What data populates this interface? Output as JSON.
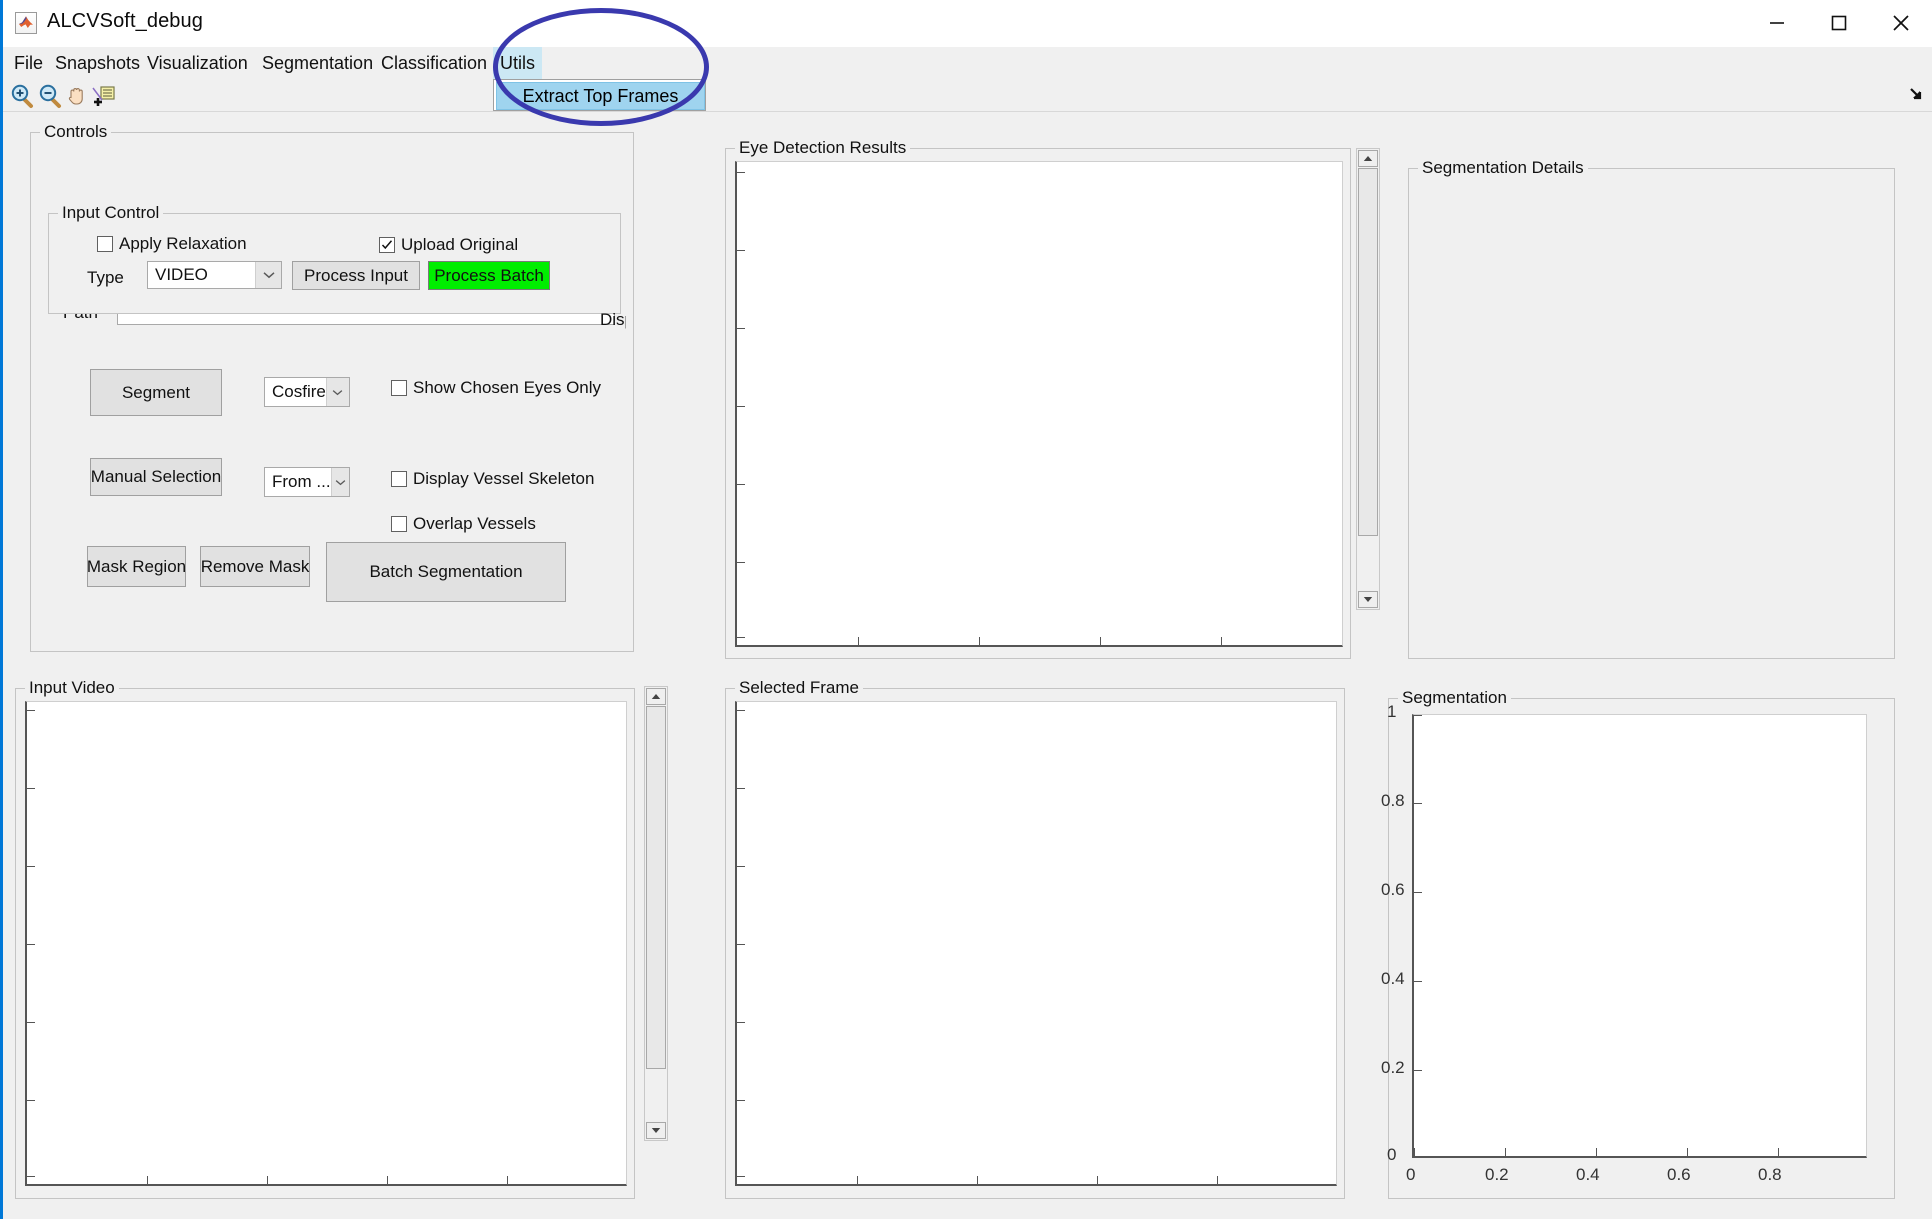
{
  "window": {
    "title": "ALCVSoft_debug",
    "icon": "matlab-app-icon",
    "minimize_label": "—",
    "maximize_label": "□",
    "close_label": "✕"
  },
  "menubar": {
    "items": [
      {
        "label": "File",
        "active": false
      },
      {
        "label": "Snapshots",
        "active": false
      },
      {
        "label": "Visualization",
        "active": false
      },
      {
        "label": "Segmentation",
        "active": false
      },
      {
        "label": "Classification",
        "active": false
      },
      {
        "label": "Utils",
        "active": true
      }
    ]
  },
  "dropdown": {
    "open": true,
    "items": [
      {
        "label": "Extract Top Frames",
        "highlighted": true
      }
    ]
  },
  "annotation": {
    "shape": "ellipse",
    "color": "#3a39ae"
  },
  "toolbar": {
    "buttons": [
      {
        "name": "zoom-in-icon",
        "tooltip": "Zoom In"
      },
      {
        "name": "zoom-out-icon",
        "tooltip": "Zoom Out"
      },
      {
        "name": "pan-hand-icon",
        "tooltip": "Pan"
      },
      {
        "name": "data-cursor-icon",
        "tooltip": "Data Cursor"
      }
    ]
  },
  "controls": {
    "title": "Controls",
    "path": {
      "label": "Path",
      "value": "",
      "placeholder": ""
    },
    "input_control": {
      "title": "Input Control",
      "apply_relaxation": {
        "label": "Apply Relaxation",
        "checked": false
      },
      "upload_original": {
        "label": "Upload Original",
        "checked": true
      },
      "type_label": "Type",
      "type_value": "VIDEO",
      "process_input": "Process Input",
      "process_batch": "Process Batch",
      "process_batch_color": "#00ee00"
    },
    "segment_button": "Segment",
    "segment_method": "Cosfire",
    "show_chosen_eyes_only": {
      "label": "Show Chosen Eyes Only",
      "checked": false
    },
    "manual_selection_button": "Manual Selection",
    "manual_selection_source": "From ...",
    "display_vessel_skeleton": {
      "label": "Display Vessel Skeleton",
      "checked": false
    },
    "overlap_vessels": {
      "label": "Overlap Vessels",
      "checked": false
    },
    "mask_region_button": "Mask Region",
    "remove_mask_button": "Remove Mask",
    "batch_segmentation_button": "Batch Segmentation",
    "clipped_display_text": "Display"
  },
  "panels": {
    "eye_detection_results": {
      "title": "Eye Detection Results"
    },
    "segmentation_details": {
      "title": "Segmentation Details"
    },
    "input_video": {
      "title": "Input Video"
    },
    "selected_frame": {
      "title": "Selected Frame"
    },
    "segmentation": {
      "title": "Segmentation"
    }
  },
  "chart_data": {
    "type": "line",
    "title": "Segmentation",
    "xlabel": "",
    "ylabel": "",
    "series": [],
    "x": [],
    "values": [],
    "xticks": [
      "0",
      "0.2",
      "0.4",
      "0.6",
      "0.8"
    ],
    "yticks": [
      "1",
      "0.8",
      "0.6",
      "0.4",
      "0.2",
      "0"
    ],
    "xlim": [
      0,
      1
    ],
    "ylim": [
      0,
      1
    ],
    "grid": false,
    "legend": "none",
    "empty": true
  }
}
